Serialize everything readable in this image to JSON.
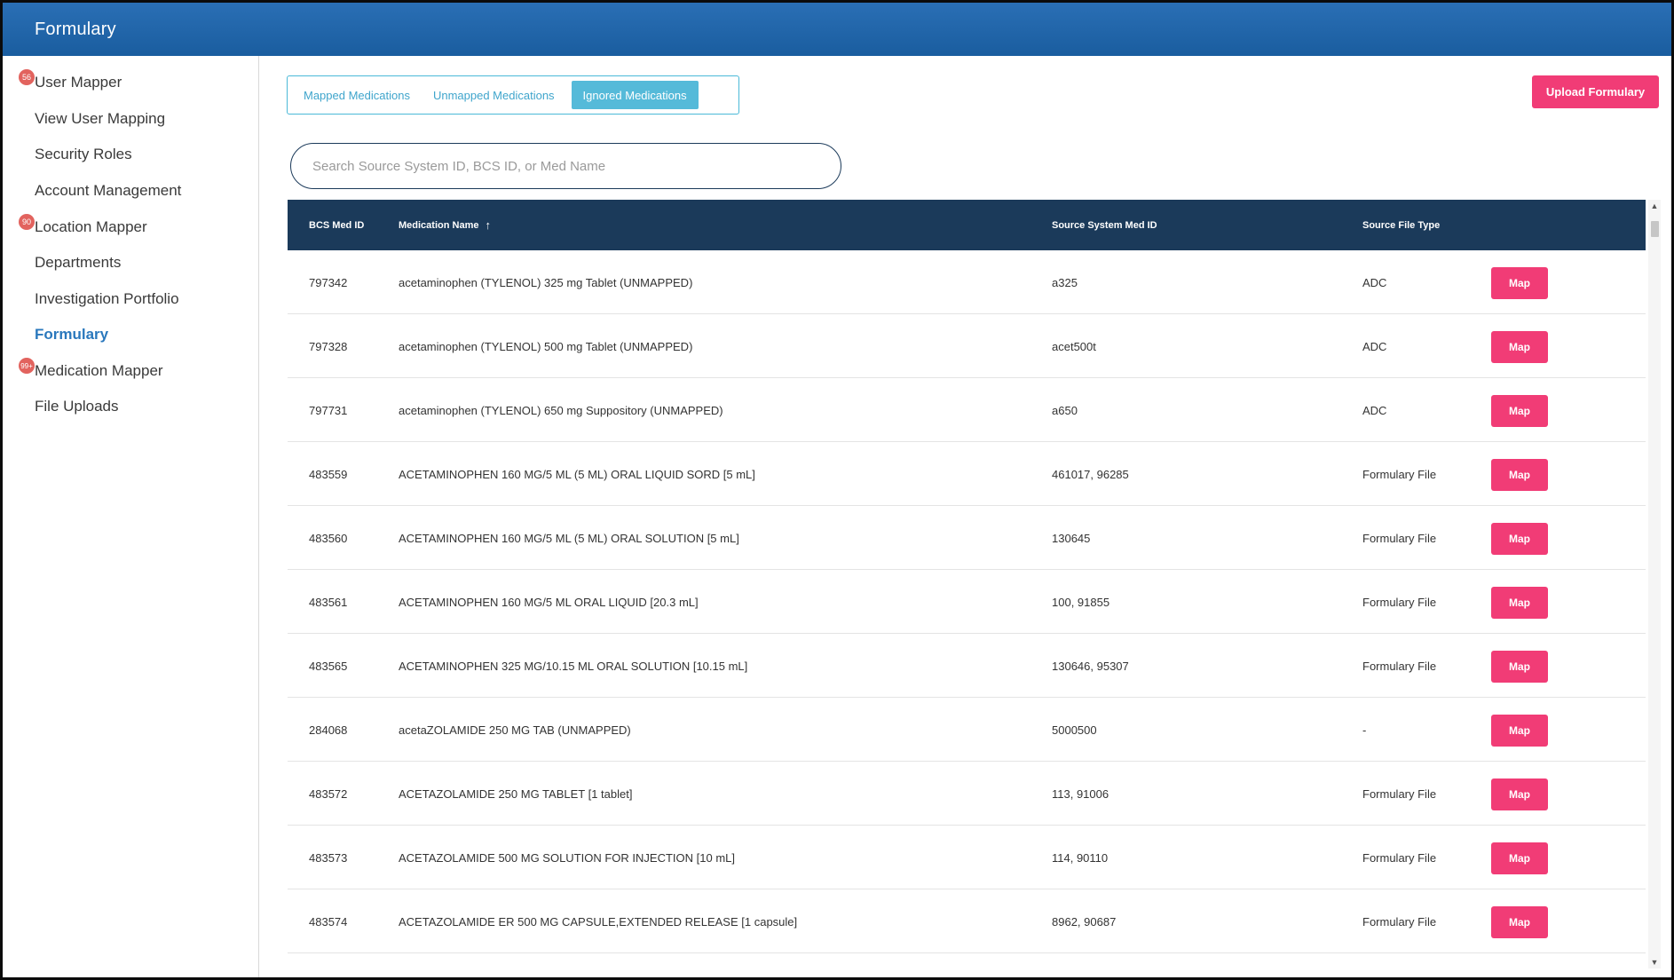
{
  "header": {
    "title": "Formulary"
  },
  "sidebar": {
    "items": [
      {
        "label": "User Mapper",
        "badge": "56"
      },
      {
        "label": "View User Mapping"
      },
      {
        "label": "Security Roles"
      },
      {
        "label": "Account Management"
      },
      {
        "label": "Location Mapper",
        "badge": "90"
      },
      {
        "label": "Departments"
      },
      {
        "label": "Investigation Portfolio"
      },
      {
        "label": "Formulary",
        "active": true
      },
      {
        "label": "Medication Mapper",
        "badge": "99+"
      },
      {
        "label": "File Uploads"
      }
    ]
  },
  "tabs": [
    {
      "label": "Mapped Medications"
    },
    {
      "label": "Unmapped Medications"
    },
    {
      "label": "Ignored Medications",
      "active": true
    }
  ],
  "toolbar": {
    "upload_label": "Upload Formulary"
  },
  "search": {
    "placeholder": "Search Source System ID, BCS ID, or Med Name",
    "value": ""
  },
  "table": {
    "columns": [
      "BCS Med ID",
      "Medication Name",
      "Source System Med ID",
      "Source File Type"
    ],
    "sort_indicator": "↑",
    "action_label": "Map",
    "rows": [
      {
        "bcs_id": "797342",
        "name": "acetaminophen (TYLENOL) 325 mg Tablet (UNMAPPED)",
        "source_id": "a325",
        "file_type": "ADC"
      },
      {
        "bcs_id": "797328",
        "name": "acetaminophen (TYLENOL) 500 mg Tablet (UNMAPPED)",
        "source_id": "acet500t",
        "file_type": "ADC"
      },
      {
        "bcs_id": "797731",
        "name": "acetaminophen (TYLENOL) 650 mg Suppository (UNMAPPED)",
        "source_id": "a650",
        "file_type": "ADC"
      },
      {
        "bcs_id": "483559",
        "name": "ACETAMINOPHEN 160 MG/5 ML (5 ML) ORAL LIQUID SORD [5 mL]",
        "source_id": "461017, 96285",
        "file_type": "Formulary File"
      },
      {
        "bcs_id": "483560",
        "name": "ACETAMINOPHEN 160 MG/5 ML (5 ML) ORAL SOLUTION [5 mL]",
        "source_id": "130645",
        "file_type": "Formulary File"
      },
      {
        "bcs_id": "483561",
        "name": "ACETAMINOPHEN 160 MG/5 ML ORAL LIQUID [20.3 mL]",
        "source_id": "100, 91855",
        "file_type": "Formulary File"
      },
      {
        "bcs_id": "483565",
        "name": "ACETAMINOPHEN 325 MG/10.15 ML ORAL SOLUTION [10.15 mL]",
        "source_id": "130646, 95307",
        "file_type": "Formulary File"
      },
      {
        "bcs_id": "284068",
        "name": "acetaZOLAMIDE 250 MG TAB (UNMAPPED)",
        "source_id": "5000500",
        "file_type": "-"
      },
      {
        "bcs_id": "483572",
        "name": "ACETAZOLAMIDE 250 MG TABLET [1 tablet]",
        "source_id": "113, 91006",
        "file_type": "Formulary File"
      },
      {
        "bcs_id": "483573",
        "name": "ACETAZOLAMIDE 500 MG SOLUTION FOR INJECTION [10 mL]",
        "source_id": "114, 90110",
        "file_type": "Formulary File"
      },
      {
        "bcs_id": "483574",
        "name": "ACETAZOLAMIDE ER 500 MG CAPSULE,EXTENDED RELEASE [1 capsule]",
        "source_id": "8962, 90687",
        "file_type": "Formulary File"
      }
    ]
  }
}
